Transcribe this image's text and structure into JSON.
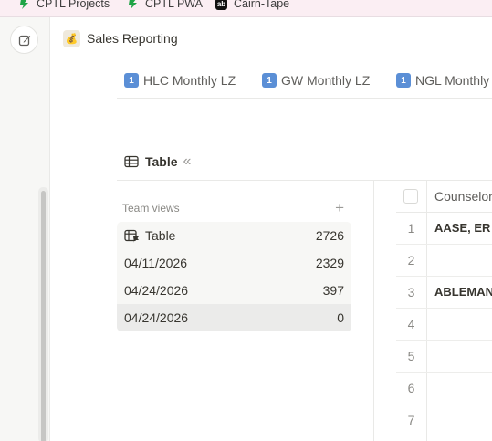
{
  "bookmarks": [
    {
      "label": "CPTL Projects",
      "icon": "green-s-icon",
      "color": "#1ea446"
    },
    {
      "label": "CPTL PWA",
      "icon": "green-s-icon",
      "color": "#1ea446"
    },
    {
      "label": "Cairn-Tape",
      "icon": "dark-logo-icon",
      "color": "#111111"
    }
  ],
  "page": {
    "emoji": "💰",
    "title": "Sales Reporting"
  },
  "tabs": [
    {
      "key": "1",
      "label": "HLC Monthly LZ"
    },
    {
      "key": "1",
      "label": "GW Monthly LZ"
    },
    {
      "key": "1",
      "label": "NGL Monthly"
    }
  ],
  "view_header": {
    "label": "Table",
    "collapse": "«"
  },
  "team_views": {
    "heading": "Team views",
    "add": "+",
    "items": [
      {
        "label": "Table",
        "count": "2726"
      },
      {
        "label": "04/11/2026",
        "count": "2329"
      },
      {
        "label": "04/24/2026",
        "count": "397"
      },
      {
        "label": "04/24/2026",
        "count": "0"
      }
    ]
  },
  "table": {
    "column": "Counselor",
    "rows": [
      {
        "num": "1",
        "value": "AASE, ER"
      },
      {
        "num": "2",
        "value": ""
      },
      {
        "num": "3",
        "value": "ABLEMAN"
      },
      {
        "num": "4",
        "value": ""
      },
      {
        "num": "5",
        "value": ""
      },
      {
        "num": "6",
        "value": ""
      },
      {
        "num": "7",
        "value": ""
      }
    ]
  },
  "colors": {
    "accent": "#5b8fd6",
    "bookmark_bar": "#fbeef3",
    "sidebar": "#f7f7f5"
  }
}
